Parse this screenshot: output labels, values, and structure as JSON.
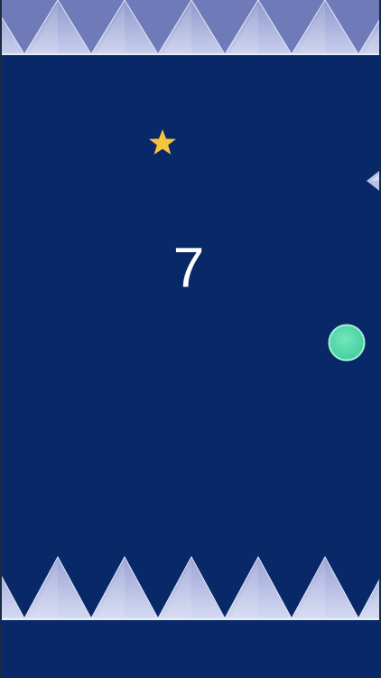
{
  "score": "7",
  "colors": {
    "background": "#082868",
    "spike_fill": "#b8c0e4",
    "spike_highlight": "#e4e8f8",
    "ball": "#4fd8a8",
    "star": "#f6c43c"
  },
  "icons": {
    "collectible": "star-icon",
    "player": "ball",
    "hazard": "spike-icon"
  }
}
